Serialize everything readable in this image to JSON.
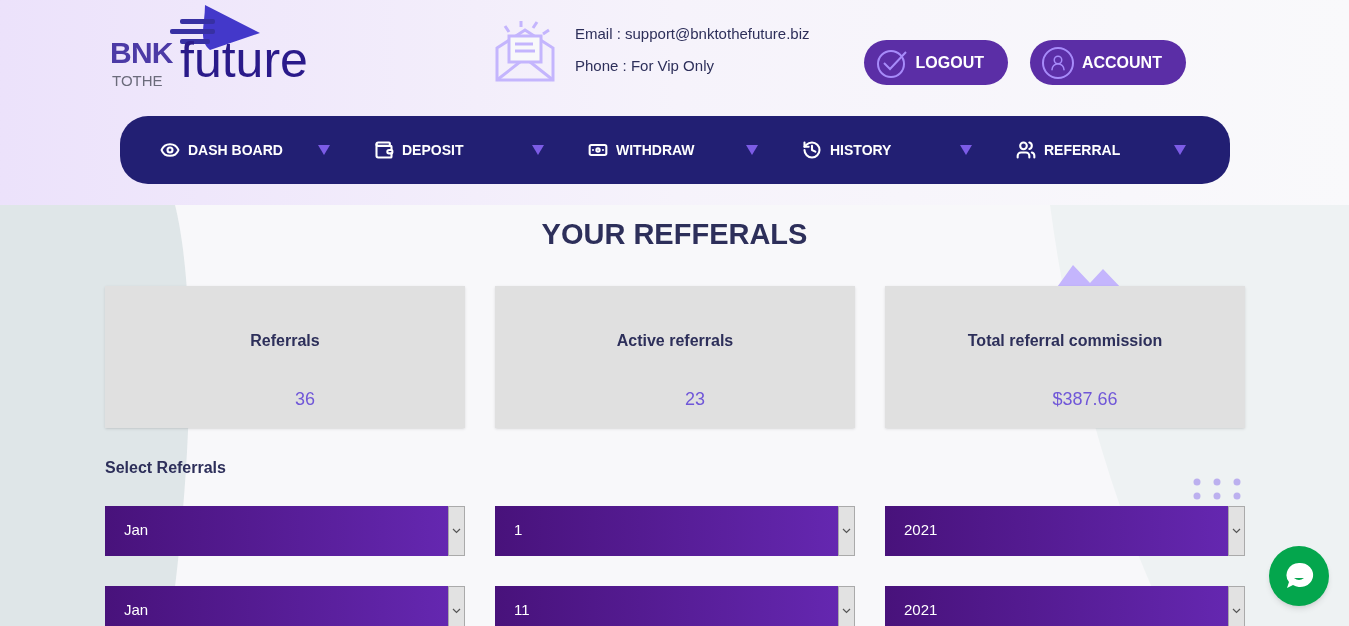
{
  "logo": {
    "word_1": "BNK",
    "word_2": "TOTHE",
    "word_3": "future"
  },
  "contact": {
    "email": "Email : support@bnktothefuture.biz",
    "phone": "Phone : For Vip Only"
  },
  "header_buttons": [
    {
      "label": "LOGOUT",
      "kind": "logout"
    },
    {
      "label": "ACCOUNT",
      "kind": "account"
    }
  ],
  "nav": [
    {
      "label": "DASH BOARD",
      "kind": "eye"
    },
    {
      "label": "DEPOSIT",
      "kind": "wallet"
    },
    {
      "label": "WITHDRAW",
      "kind": "cash"
    },
    {
      "label": "HISTORY",
      "kind": "clock"
    },
    {
      "label": "REFERRAL",
      "kind": "people"
    }
  ],
  "title": "YOUR REFFERALS",
  "stats": [
    {
      "label": "Referrals",
      "value": "36"
    },
    {
      "label": "Active referrals",
      "value": "23"
    },
    {
      "label": "Total referral commission",
      "value": "$387.66"
    }
  ],
  "select_heading": "Select Referrals",
  "select_rows": [
    [
      "Jan",
      "1",
      "2021"
    ],
    [
      "Jan",
      "11",
      "2021"
    ]
  ]
}
